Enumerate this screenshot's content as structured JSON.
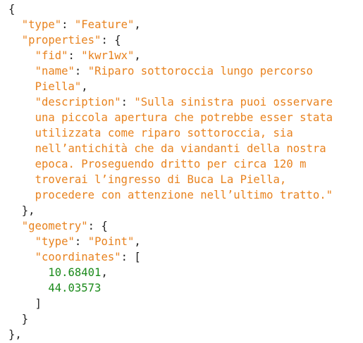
{
  "colors": {
    "key": "#e8821e",
    "string": "#e8821e",
    "number": "#1a8a1a",
    "punctuation": "#222222"
  },
  "json": {
    "type_key": "\"type\"",
    "type_value": "\"Feature\"",
    "properties_key": "\"properties\"",
    "properties": {
      "fid_key": "\"fid\"",
      "fid_value": "\"kwr1wx\"",
      "name_key": "\"name\"",
      "name_value_lines": [
        "\"Riparo sottoroccia lungo percorso",
        "Piella\""
      ],
      "description_key": "\"description\"",
      "description_value_lines": [
        "\"Sulla sinistra puoi osservare",
        "una piccola apertura che potrebbe esser stata",
        "utilizzata come riparo sottoroccia, sia",
        "nell’antichità che da viandanti della nostra",
        "epoca. Proseguendo dritto per circa 120 m",
        "troverai l’ingresso di Buca La Piella,",
        "procedere con attenzione nell’ultimo tratto.\""
      ]
    },
    "geometry_key": "\"geometry\"",
    "geometry": {
      "type_key": "\"type\"",
      "type_value": "\"Point\"",
      "coordinates_key": "\"coordinates\"",
      "coordinates": [
        "10.68401",
        "44.03573"
      ]
    }
  }
}
